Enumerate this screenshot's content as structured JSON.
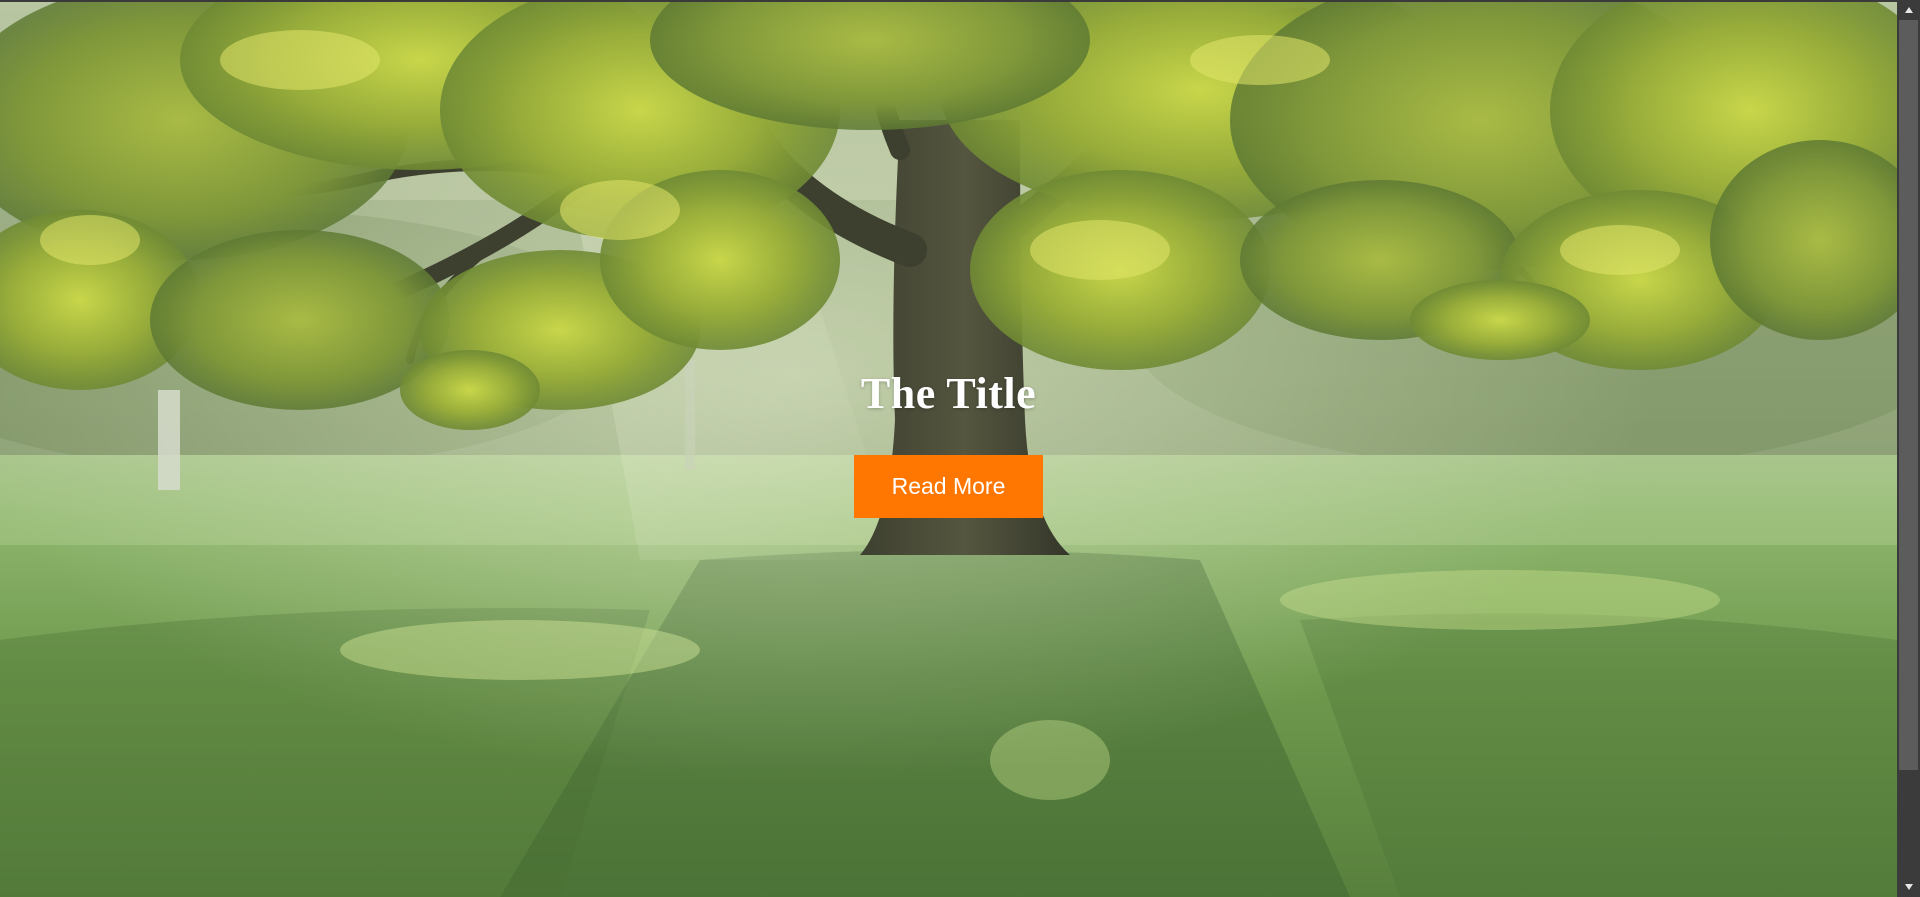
{
  "hero": {
    "title": "The Title",
    "button_label": "Read More",
    "button_color": "#ff7700",
    "background_image": "tree-in-meadow-photo"
  },
  "scrollbar": {
    "up_icon": "triangle-up-icon",
    "down_icon": "triangle-down-icon"
  }
}
